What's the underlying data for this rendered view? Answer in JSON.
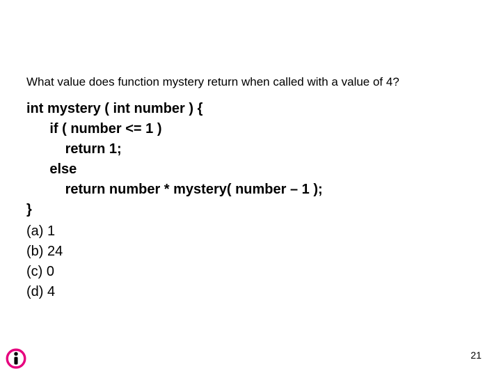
{
  "question": "What value does function mystery return when called with a value of 4?",
  "code": {
    "l1": "int mystery ( int number ) {",
    "l2": "      if ( number <= 1 )",
    "l3": "          return 1;",
    "l4": "      else",
    "l5": "          return number * mystery( number – 1 );",
    "l6": "}"
  },
  "options": {
    "a": "(a) 1",
    "b": "(b) 24",
    "c": "(c) 0",
    "d": "(d) 4"
  },
  "page_number": "21",
  "colors": {
    "logo_pink": "#e6007e",
    "logo_black": "#000000"
  }
}
